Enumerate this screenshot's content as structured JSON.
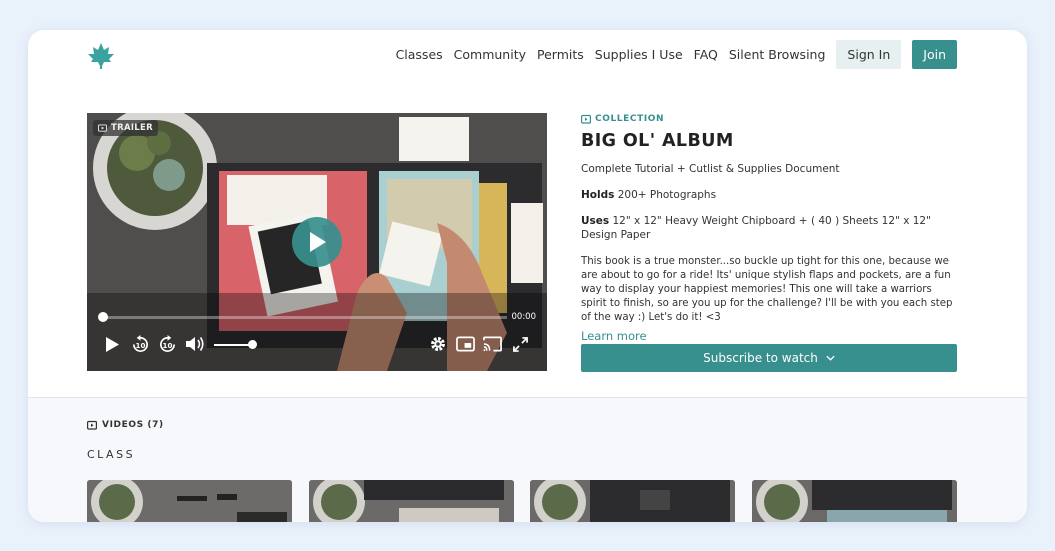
{
  "header": {
    "nav": [
      {
        "id": "classes",
        "label": "Classes"
      },
      {
        "id": "community",
        "label": "Community"
      },
      {
        "id": "permits",
        "label": "Permits"
      },
      {
        "id": "supplies",
        "label": "Supplies I Use"
      },
      {
        "id": "faq",
        "label": "FAQ"
      },
      {
        "id": "silent",
        "label": "Silent Browsing"
      }
    ],
    "sign_in": "Sign In",
    "join": "Join"
  },
  "video": {
    "badge": "TRAILER",
    "time": "00:00",
    "progress": 0,
    "volume": 0.9
  },
  "collection": {
    "label": "COLLECTION",
    "title": "BIG OL' ALBUM",
    "subtitle": "Complete Tutorial + Cutlist & Supplies Document",
    "holds_label": "Holds",
    "holds_value": " 200+ Photographs",
    "uses_label": "Uses",
    "uses_value": " 12\" x 12\" Heavy Weight Chipboard + ( 40 ) Sheets 12\" x 12\" Design Paper",
    "description": "This book is a true monster...so buckle up tight for this one, because we are about to go for a ride! Its' unique stylish flaps and pockets, are a fun way to display your happiest memories! This one will take a warriors spirit to finish, so are you up for the challenge? I'll be with you each step of the way :) Let's do it! <3",
    "learn_more": "Learn more",
    "subscribe": "Subscribe to watch"
  },
  "videos": {
    "label": "VIDEOS (7)",
    "section": "CLASS"
  },
  "colors": {
    "accent": "#378f8e",
    "page_bg": "#e9f1fb"
  }
}
